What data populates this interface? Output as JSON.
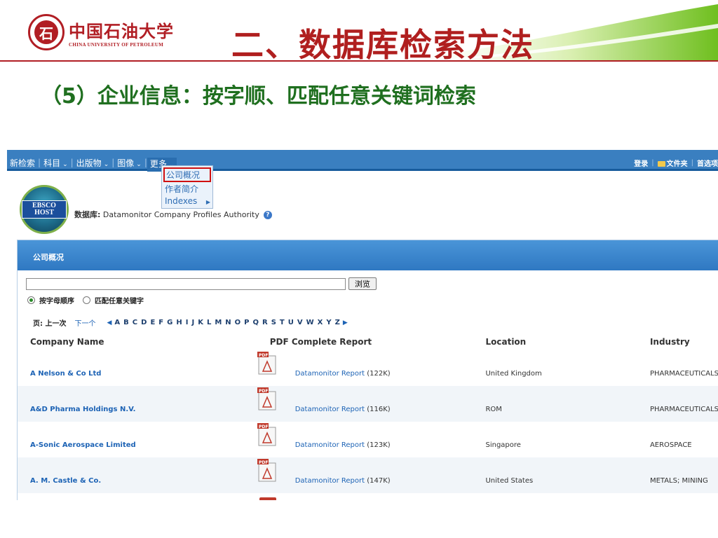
{
  "slide": {
    "university_cn": "中国石油大学",
    "university_en": "CHINA UNIVERSITY OF PETROLEUM",
    "title": "二、数据库检索方法",
    "subtitle": "（5）企业信息：按字顺、匹配任意关键词检索",
    "colors": {
      "title": "#b01f1f",
      "subtitle": "#1f6f1f",
      "accent_green": "#7fbf2a",
      "brand_red": "#b11e24"
    }
  },
  "nav": {
    "items": [
      "新检索",
      "科目",
      "出版物",
      "图像",
      "更多"
    ],
    "right": [
      "登录",
      "文件夹",
      "首选项"
    ],
    "folder_icon": "folder-icon",
    "color": "#3a7fc0"
  },
  "more_menu": {
    "items": [
      {
        "label": "公司概况",
        "active": true
      },
      {
        "label": "作者简介",
        "active": false
      },
      {
        "label": "Indexes",
        "active": false,
        "has_submenu": true
      }
    ]
  },
  "ebsco": {
    "logo_text": "EBSCO HOST",
    "db_prefix": "数据库:",
    "db_name": "Datamonitor Company Profiles Authority",
    "help_icon": "?"
  },
  "panel": {
    "header": "公司概况",
    "search_value": "",
    "browse_label": "浏览",
    "radio_options": [
      {
        "label": "按字母顺序",
        "checked": true
      },
      {
        "label": "匹配任意关键字",
        "checked": false
      }
    ],
    "page_label": "页: 上一次",
    "next_label": "下一个",
    "letters": [
      "A",
      "B",
      "C",
      "D",
      "E",
      "F",
      "G",
      "H",
      "I",
      "J",
      "K",
      "L",
      "M",
      "N",
      "O",
      "P",
      "Q",
      "R",
      "S",
      "T",
      "U",
      "V",
      "W",
      "X",
      "Y",
      "Z"
    ]
  },
  "table": {
    "columns": [
      "Company Name",
      "PDF Complete Report",
      "Location",
      "Industry"
    ],
    "rows": [
      {
        "name": "A Nelson & Co Ltd",
        "report": "Datamonitor Report",
        "size": "(122K)",
        "location": "United Kingdom",
        "industry": "PHARMACEUTICALS"
      },
      {
        "name": "A&D Pharma Holdings N.V.",
        "report": "Datamonitor Report",
        "size": "(116K)",
        "location": "ROM",
        "industry": "PHARMACEUTICALS"
      },
      {
        "name": "A-Sonic Aerospace Limited",
        "report": "Datamonitor Report",
        "size": "(123K)",
        "location": "Singapore",
        "industry": "AEROSPACE"
      },
      {
        "name": "A. M. Castle & Co.",
        "report": "Datamonitor Report",
        "size": "(147K)",
        "location": "United States",
        "industry": "METALS; MINING"
      }
    ]
  }
}
